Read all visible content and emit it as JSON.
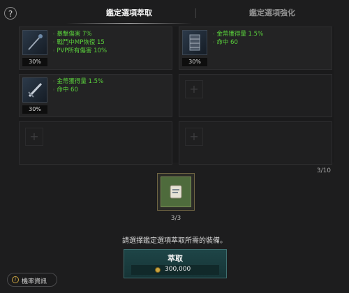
{
  "help": {
    "icon": "question-icon",
    "glyph": "?"
  },
  "tabs": [
    {
      "label": "鑑定選項萃取",
      "active": true
    },
    {
      "label": "鑑定選項強化",
      "active": false
    }
  ],
  "slots": [
    {
      "icon": "staff-weapon-icon",
      "percent": "30%",
      "stats": [
        "暴擊傷害 7%",
        "戰鬥中MP恢復 15",
        "PVP所有傷害 10%"
      ]
    },
    {
      "icon": "belt-armor-icon",
      "percent": "30%",
      "stats": [
        "金幣獲得量 1.5%",
        "命中 60"
      ]
    },
    {
      "icon": "sword-weapon-icon",
      "percent": "30%",
      "stats": [
        "金幣獲得量 1.5%",
        "命中 60"
      ]
    },
    {
      "empty": true
    },
    {
      "empty": true
    },
    {
      "empty": true
    }
  ],
  "empty_glyph": "+",
  "list_count": "3/10",
  "material": {
    "icon": "scroll-icon",
    "count": "3/3"
  },
  "instruction": "請選擇鑑定選項萃取所需的裝備。",
  "extract": {
    "label": "萃取",
    "cost": "300,000",
    "currency_icon": "coin-icon"
  },
  "rate_info": {
    "label": "機率資訊",
    "icon": "info-icon",
    "glyph": "i"
  },
  "colors": {
    "stat_green": "#5ad03c",
    "button_teal": "#1e4547",
    "frame_gold": "#6e6442"
  }
}
